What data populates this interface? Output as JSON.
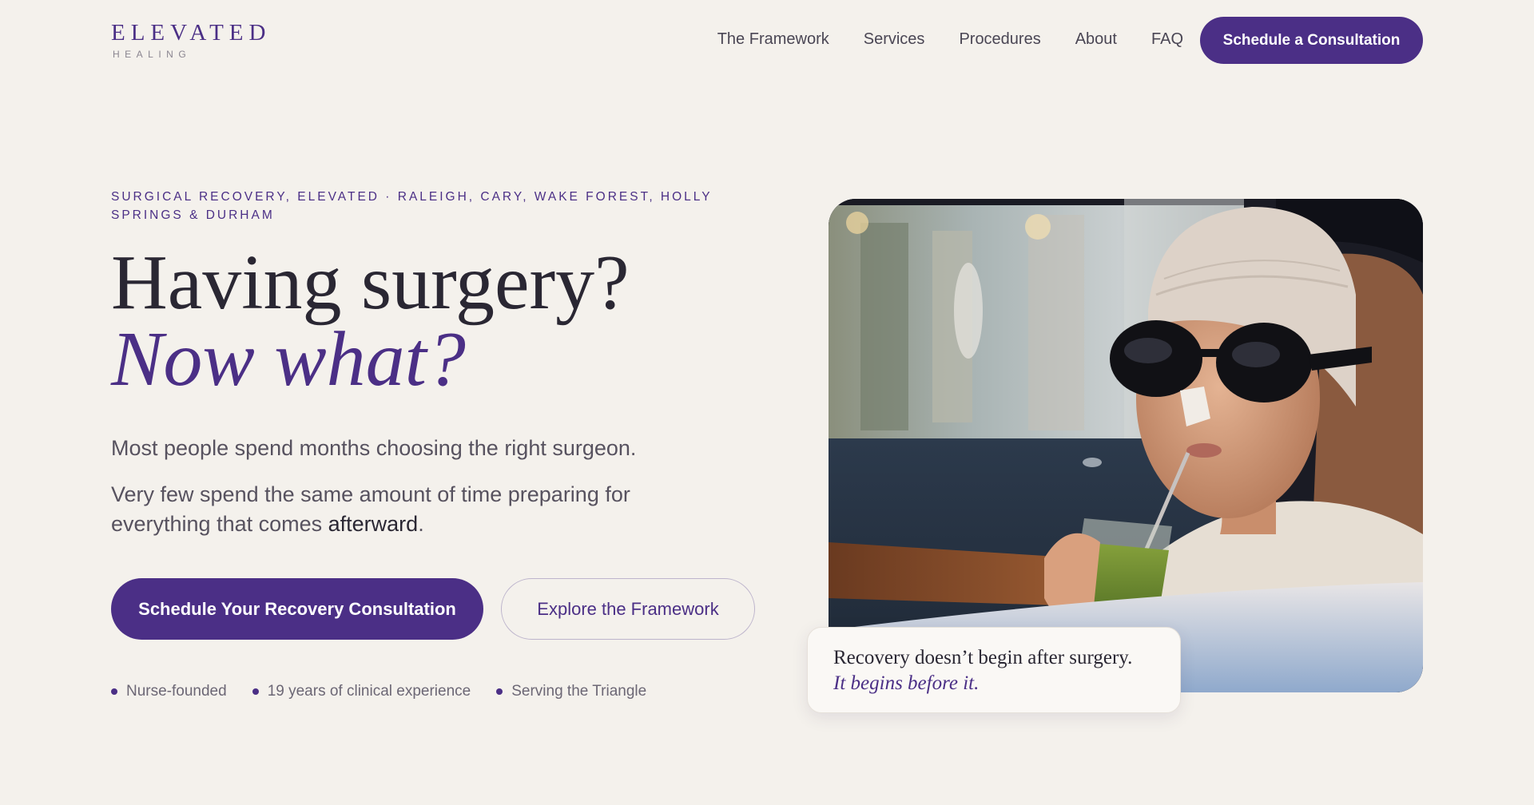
{
  "header": {
    "logo_main": "ELEVATED",
    "logo_sub": "HEALING",
    "nav": [
      "The Framework",
      "Services",
      "Procedures",
      "About",
      "FAQ"
    ],
    "cta": "Schedule a Consultation"
  },
  "hero": {
    "eyebrow": "Surgical Recovery, Elevated · Raleigh, Cary, Wake Forest, Holly Springs & Durham",
    "headline": "Having surgery?",
    "headline_em": "Now what?",
    "paragraph1": "Most people spend months choosing the right surgeon.",
    "paragraph2_start": "Very few spend the same amount of time preparing for everything that comes ",
    "paragraph2_emph": "afterward",
    "paragraph2_end": ".",
    "primary_button": "Schedule Your Recovery Consultation",
    "secondary_button": "Explore the Framework",
    "trust_points": [
      "Nurse-founded",
      "19 years of clinical experience",
      "Serving the Triangle"
    ]
  },
  "quote_card": {
    "line1": "Recovery doesn’t begin after surgery.",
    "line2": "It begins before it."
  },
  "colors": {
    "accent": "#4b2f86",
    "background": "#f4f1ec",
    "text": "#2a2733"
  }
}
